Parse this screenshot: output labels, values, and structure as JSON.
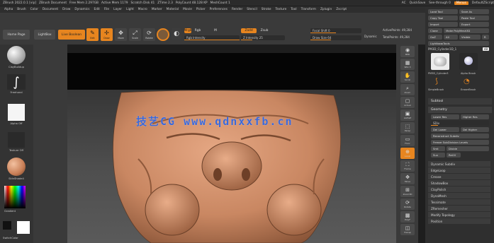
{
  "titlebar": {
    "items": [
      "ZBrush 2022.0.1 [vip]",
      "ZBrush Document",
      "Free Mem 2.297GB",
      "Active Mem 1179",
      "Scratch Disk 41",
      "ZTime 2.3",
      "PolyCount 48.128 KP",
      "MeshCount 1"
    ],
    "right": [
      "AC",
      "QuickSave",
      "See-through 0",
      "Menus",
      "DefaultZScript"
    ],
    "highlight": "Menus"
  },
  "menubar": {
    "items": [
      "Alpha",
      "Brush",
      "Color",
      "Document",
      "Draw",
      "Dynamics",
      "Edit",
      "File",
      "Layer",
      "Light",
      "Macro",
      "Marker",
      "Material",
      "Movie",
      "Picker",
      "Preferences",
      "Render",
      "Stencil",
      "Stroke",
      "Texture",
      "Tool",
      "Transform",
      "Zplugin",
      "Zscript"
    ]
  },
  "shelf": {
    "home_page": "Home Page",
    "lightbox": "LightBox",
    "live_boolean": "Live Boolean",
    "edit": "Edit",
    "draw": "Draw",
    "move": "Move",
    "scale": "Scale",
    "rotate": "Rotate",
    "mrgb": "Mrgb",
    "rgb": "Rgb",
    "m": "M",
    "zadd": "Zadd",
    "zsub": "Zsub",
    "z_intensity": "Z Intensity 25",
    "focal_shift": "Focal Shift 0",
    "draw_size": "Draw Size 64",
    "dynamic": "Dynamic",
    "active_points": "ActivePoints: 49,284",
    "total_points": "TotalPoints: 49,284",
    "rgb_intensity": "Rgb Intensity"
  },
  "left_panel": {
    "brush_label": "ClayBuildup",
    "stroke_label": "Freehand",
    "alpha_label": "Alpha Off",
    "texture_label": "Texture Off",
    "material_label": "SkinShade4",
    "gradient_label": "Gradient",
    "switch_label": "SwitchColor"
  },
  "right_strip": {
    "buttons": [
      "BPR",
      "SPix 3",
      "Scroll",
      "Zoom",
      "Actual",
      "AAHalf",
      "Persp",
      "Floor",
      "Local",
      "Frame",
      "Move",
      "Zoom3D",
      "Rotate",
      "Line Fill",
      "PolyF",
      "Transp",
      "Ghost",
      "Solo",
      "Xpose"
    ],
    "active": "Local"
  },
  "right_panel": {
    "load_tool": "Load Tool",
    "save_as": "Save As",
    "copy_tool": "Copy Tool",
    "paste_tool": "Paste Tool",
    "import": "Import",
    "export": "Export",
    "clone": "Clone",
    "make_polymesh": "Make PolyMesh3D",
    "goz": "GoZ",
    "all": "All",
    "visible": "Visible",
    "r": "R",
    "lightbox_tools": "Lightbox▸Tools",
    "current_tool": "PM3D_Cylinder3D_1",
    "r_value": "R",
    "count": "48",
    "thumb1": "PM3D_Cylinder3",
    "thumb2": "Alpha Brush",
    "thumb3": "SimpleBrush",
    "thumb4": "EraserBrush",
    "subtool": "Subtool",
    "geometry": "Geometry",
    "lower_res": "Lower Res",
    "higher_res": "Higher Res",
    "sdiv": "SDiv",
    "del_lower": "Del Lower",
    "del_higher": "Del Higher",
    "reconstruct": "Reconstruct Subdiv",
    "freeze": "Freeze SubDivision Levels",
    "smt": "Smt",
    "divide": "Divide",
    "suv": "Suv",
    "reuv": "ReUV",
    "dynamic_subdiv": "Dynamic Subdiv",
    "edgeloop": "EdgeLoop",
    "crease": "Crease",
    "shadowbox": "ShadowBox",
    "claypolish": "ClayPolish",
    "dynamesh": "DynaMesh",
    "tessimate": "Tessimate",
    "zremesher": "ZRemesher",
    "modify_topology": "Modify Topology",
    "position": "Position"
  },
  "watermark": "技艺CG www.qdnxxfb.cn",
  "colors": {
    "accent": "#e7851f",
    "skin": "#d8916a",
    "watermark": "#3b68d9"
  }
}
